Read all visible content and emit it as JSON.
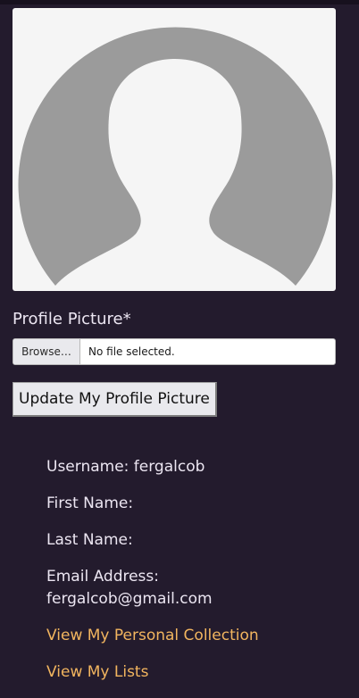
{
  "profile": {
    "picture_label": "Profile Picture*",
    "browse_label": "Browse…",
    "file_status": "No file selected.",
    "update_button_label": "Update My Profile Picture"
  },
  "user": {
    "username_line": "Username: fergalcob",
    "first_name_line": "First Name:",
    "last_name_line": "Last Name:",
    "email_label": "Email Address:",
    "email_value": "fergalcob@gmail.com"
  },
  "links": {
    "collection": "View My Personal Collection",
    "lists": "View My Lists"
  },
  "colors": {
    "background": "#231b2d",
    "link": "#f2b55f",
    "avatar_silhouette": "#9b9b9b"
  }
}
